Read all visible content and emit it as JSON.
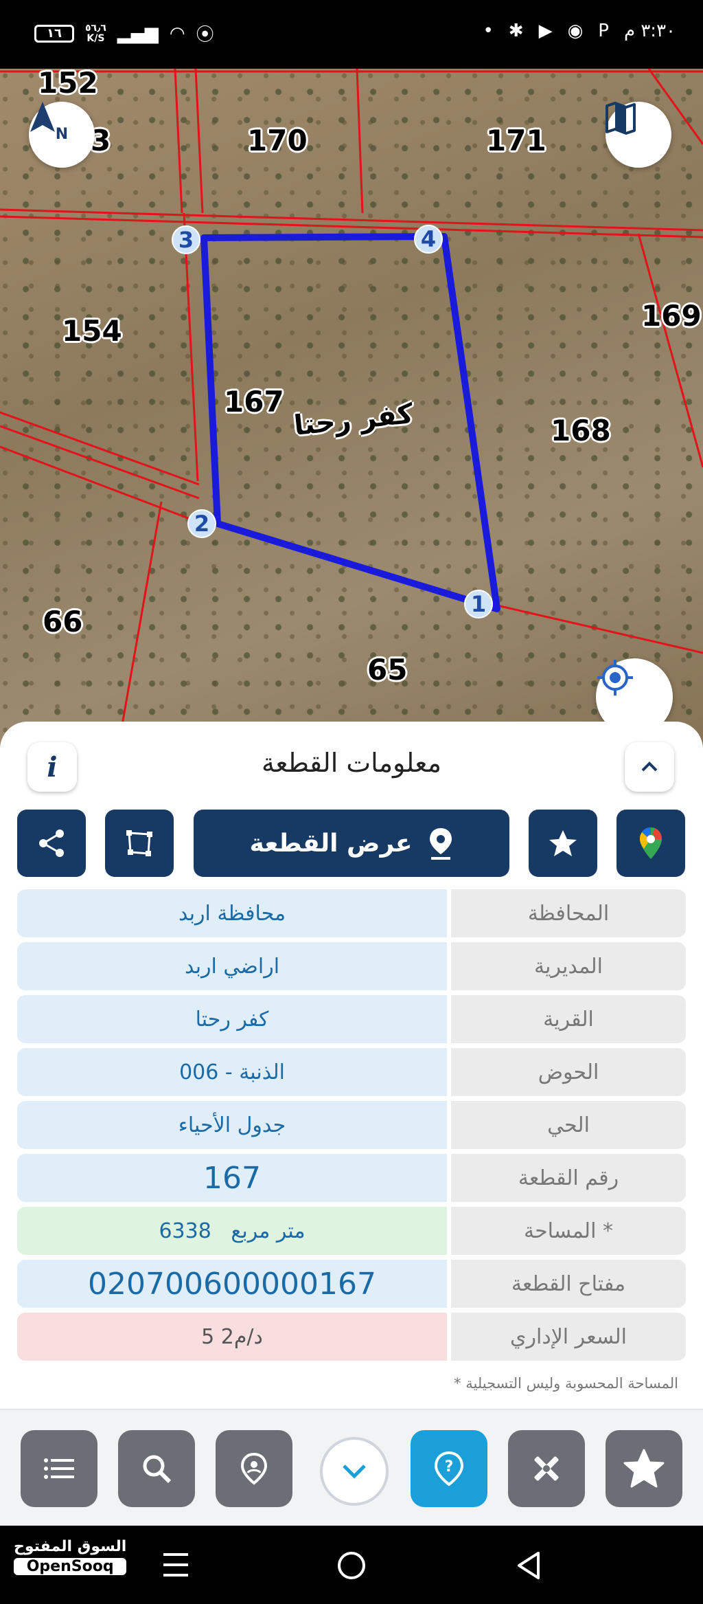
{
  "status_bar": {
    "battery": "١٦",
    "net_speed": "٥٦٫٦",
    "net_unit": "K/S",
    "time": "٣:٣٠ م"
  },
  "map": {
    "plots": [
      "152",
      "3",
      "170",
      "171",
      "154",
      "169",
      "167",
      "168",
      "66",
      "65"
    ],
    "village_name": "كفر رحتا",
    "vertices": [
      "1",
      "2",
      "3",
      "4"
    ],
    "north_letter": "N",
    "icons": {
      "north": "compass-north-icon",
      "layers": "map-layers-icon",
      "locate": "locate-me-icon"
    }
  },
  "panel": {
    "title": "معلومات القطعة",
    "info_icon": "i",
    "show_plot_label": "عرض القطعة",
    "rows": [
      {
        "label": "المحافظة",
        "value": "محافظة اربد"
      },
      {
        "label": "المديرية",
        "value": "اراضي اربد"
      },
      {
        "label": "القرية",
        "value": "كفر رحتا"
      },
      {
        "label": "الحوض",
        "value": "الذنبة - 006"
      },
      {
        "label": "الحي",
        "value": "جدول الأحياء"
      },
      {
        "label": "رقم القطعة",
        "value": "167"
      },
      {
        "label": "المساحة *",
        "value": "6338   متر مربع"
      },
      {
        "label": "مفتاح القطعة",
        "value": "020700600000167"
      },
      {
        "label": "السعر الإداري",
        "value": "5 د/م2"
      }
    ],
    "note": "* المساحة المحسوبة وليس التسجيلية"
  },
  "branding": {
    "arabic": "السوق المفتوح",
    "english": "OpenSooq"
  },
  "colors": {
    "primary": "#163a63",
    "accent": "#1a9fd8",
    "parcel_lines": "#e0141a",
    "selected_parcel": "#1a1adb"
  }
}
